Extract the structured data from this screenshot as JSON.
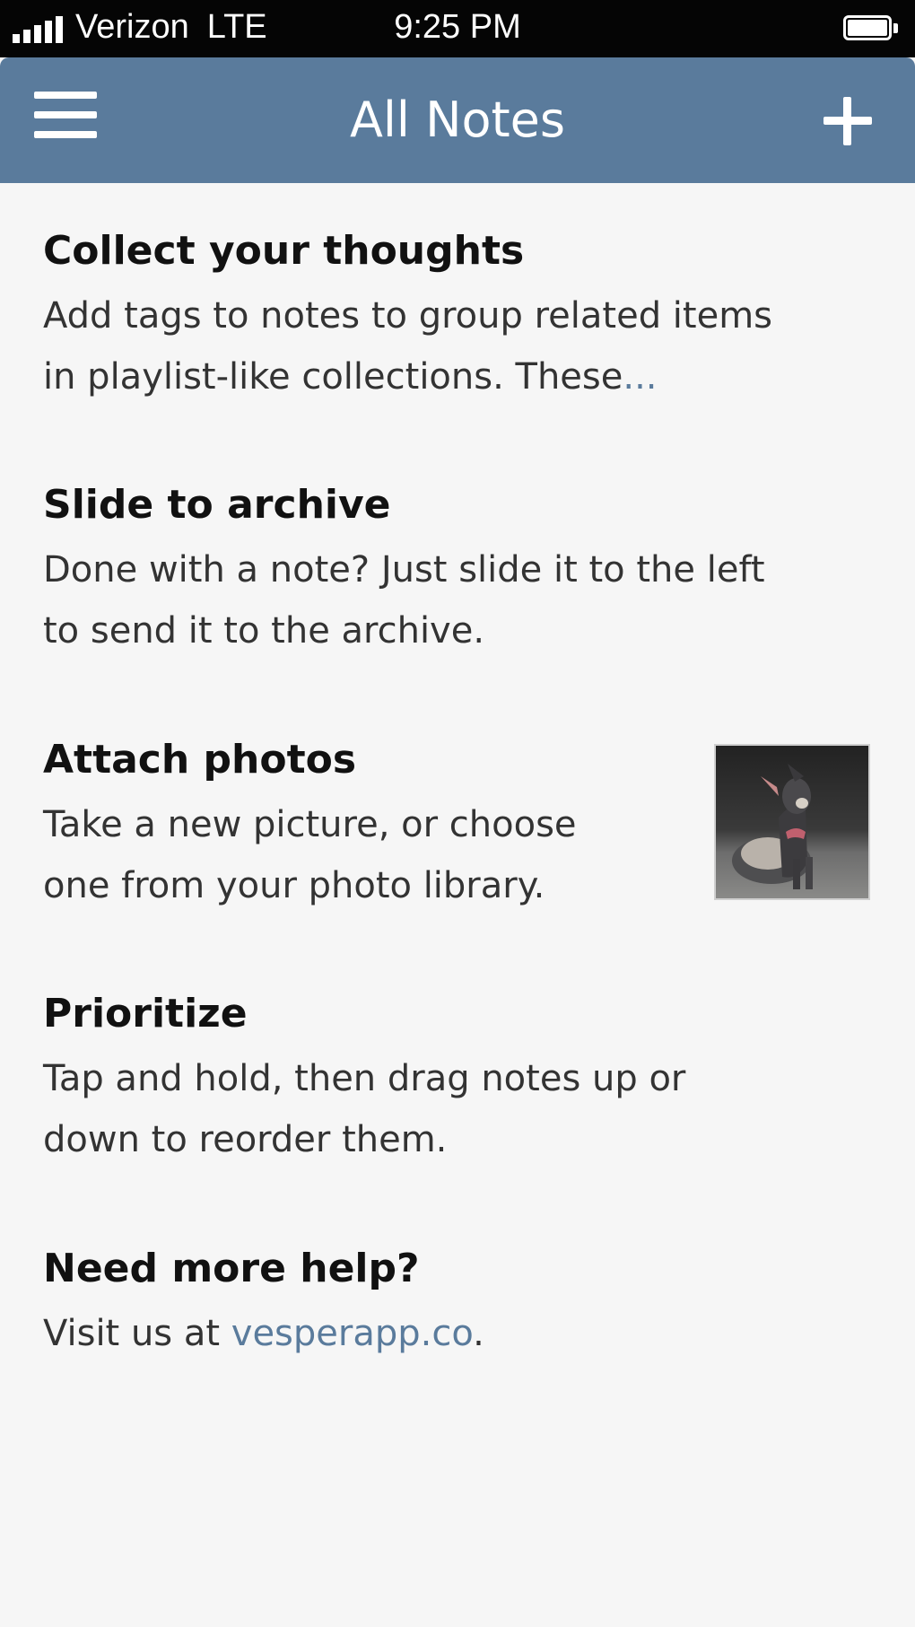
{
  "status_bar": {
    "carrier": "Verizon",
    "network": "LTE",
    "time": "9:25 PM",
    "signal_bars": 5,
    "battery_level": 0.9
  },
  "nav": {
    "title": "All Notes",
    "menu_icon": "hamburger-menu-icon",
    "add_icon": "plus-icon"
  },
  "notes": [
    {
      "title": "Collect your thoughts",
      "lines": [
        "Add tags to notes to group related items",
        "in playlist-like collections. These"
      ],
      "ellipsis": "..."
    },
    {
      "title": "Slide to archive",
      "lines": [
        "Done with a note? Just slide it to the left",
        "to send it to the archive."
      ]
    },
    {
      "title": "Attach photos",
      "lines": [
        "Take a new picture, or choose",
        "one from your photo library."
      ],
      "has_photo": true
    },
    {
      "title": "Prioritize",
      "lines": [
        "Tap and hold, then drag notes up or",
        "down to reorder them."
      ]
    },
    {
      "title": "Need more help?",
      "prefix": "Visit us at ",
      "link": "vesperapp.co",
      "suffix": "."
    }
  ],
  "colors": {
    "accent": "#5a7b9c",
    "background": "#f6f6f6",
    "status_bar": "#050505"
  }
}
